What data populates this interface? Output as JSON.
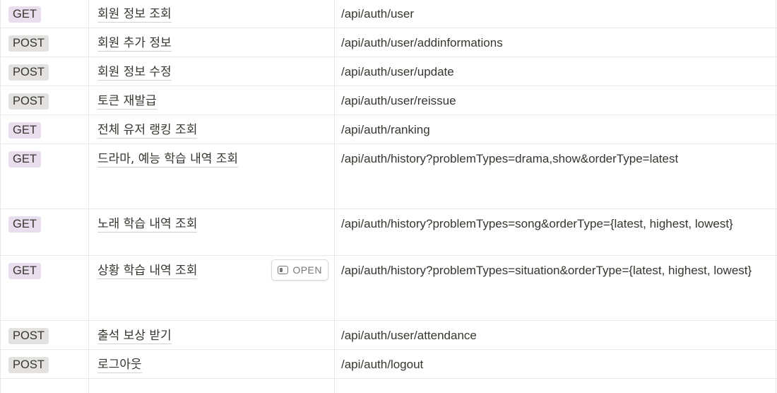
{
  "table": {
    "open_label": "OPEN",
    "rows": [
      {
        "method": "GET",
        "method_color": "#e8deee",
        "name": "회원 정보 조회",
        "endpoint": "/api/auth/user"
      },
      {
        "method": "POST",
        "method_color": "#e3e2e0",
        "name": "회원 추가 정보",
        "endpoint": "/api/auth/user/addinformations"
      },
      {
        "method": "POST",
        "method_color": "#e3e2e0",
        "name": "회원 정보 수정",
        "endpoint": "/api/auth/user/update"
      },
      {
        "method": "POST",
        "method_color": "#e3e2e0",
        "name": "토큰 재발급",
        "endpoint": "/api/auth/user/reissue"
      },
      {
        "method": "GET",
        "method_color": "#e8deee",
        "name": "전체 유저 랭킹 조회",
        "endpoint": "/api/auth/ranking"
      },
      {
        "method": "GET",
        "method_color": "#e8deee",
        "name": "드라마, 예능 학습 내역 조회",
        "endpoint": "/api/auth/history?problemTypes=drama,show&orderType=latest"
      },
      {
        "method": "GET",
        "method_color": "#e8deee",
        "name": "노래 학습 내역 조회",
        "endpoint": "/api/auth/history?problemTypes=song&orderType={latest, highest, lowest}"
      },
      {
        "method": "GET",
        "method_color": "#e8deee",
        "name": "상황 학습 내역 조회",
        "endpoint": "/api/auth/history?problemTypes=situation&orderType={latest, highest, lowest}"
      },
      {
        "method": "POST",
        "method_color": "#e3e2e0",
        "name": "출석 보상 받기",
        "endpoint": "/api/auth/user/attendance"
      },
      {
        "method": "POST",
        "method_color": "#e3e2e0",
        "name": "로그아웃",
        "endpoint": "/api/auth/logout"
      }
    ]
  }
}
